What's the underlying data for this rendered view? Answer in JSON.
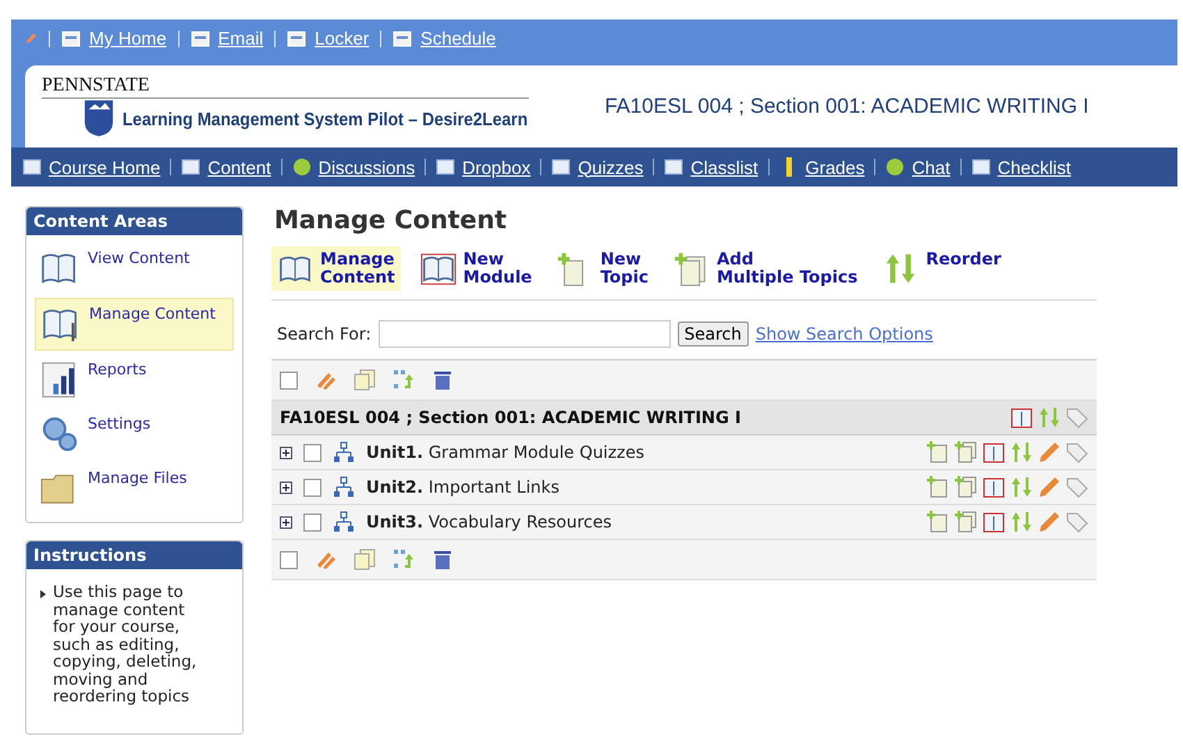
{
  "top_bar": {
    "links": [
      {
        "label": "My Home"
      },
      {
        "label": "Email"
      },
      {
        "label": "Locker"
      },
      {
        "label": "Schedule"
      }
    ]
  },
  "header": {
    "org": "PENNSTATE",
    "system": "Learning Management System Pilot – Desire2Learn",
    "course": "FA10ESL 004 ; Section 001: ACADEMIC WRITING I"
  },
  "nav": [
    {
      "label": "Course Home"
    },
    {
      "label": "Content"
    },
    {
      "label": "Discussions"
    },
    {
      "label": "Dropbox"
    },
    {
      "label": "Quizzes"
    },
    {
      "label": "Classlist"
    },
    {
      "label": "Grades"
    },
    {
      "label": "Chat"
    },
    {
      "label": "Checklist"
    }
  ],
  "sidebar": {
    "content_areas": {
      "title": "Content Areas",
      "items": [
        {
          "label": "View Content",
          "selected": false
        },
        {
          "label": "Manage Content",
          "selected": true
        },
        {
          "label": "Reports",
          "selected": false
        },
        {
          "label": "Settings",
          "selected": false
        },
        {
          "label": "Manage Files",
          "selected": false
        }
      ]
    },
    "instructions": {
      "title": "Instructions",
      "text": "Use this page to manage content for your course, such as editing, copying, deleting, moving and reordering topics"
    }
  },
  "main": {
    "title": "Manage Content",
    "toolbar": [
      {
        "label": "Manage\nContent",
        "selected": true
      },
      {
        "label": "New\nModule",
        "selected": false
      },
      {
        "label": "New\nTopic",
        "selected": false
      },
      {
        "label": "Add\nMultiple Topics",
        "selected": false
      },
      {
        "label": "Reorder",
        "selected": false
      }
    ],
    "search": {
      "label": "Search For:",
      "button": "Search",
      "options_link": "Show Search Options"
    },
    "table": {
      "top_select_all_checked": false,
      "course_title": "FA10ESL 004 ; Section 001: ACADEMIC WRITING I",
      "modules": [
        {
          "label": "**Unit1.** Grammar Module Quizzes",
          "checked": false
        },
        {
          "label": "**Unit2.** Important Links",
          "checked": false
        },
        {
          "label": "**Unit3.** Vocabulary Resources",
          "checked": false
        }
      ],
      "bottom_select_all_checked": false
    }
  }
}
